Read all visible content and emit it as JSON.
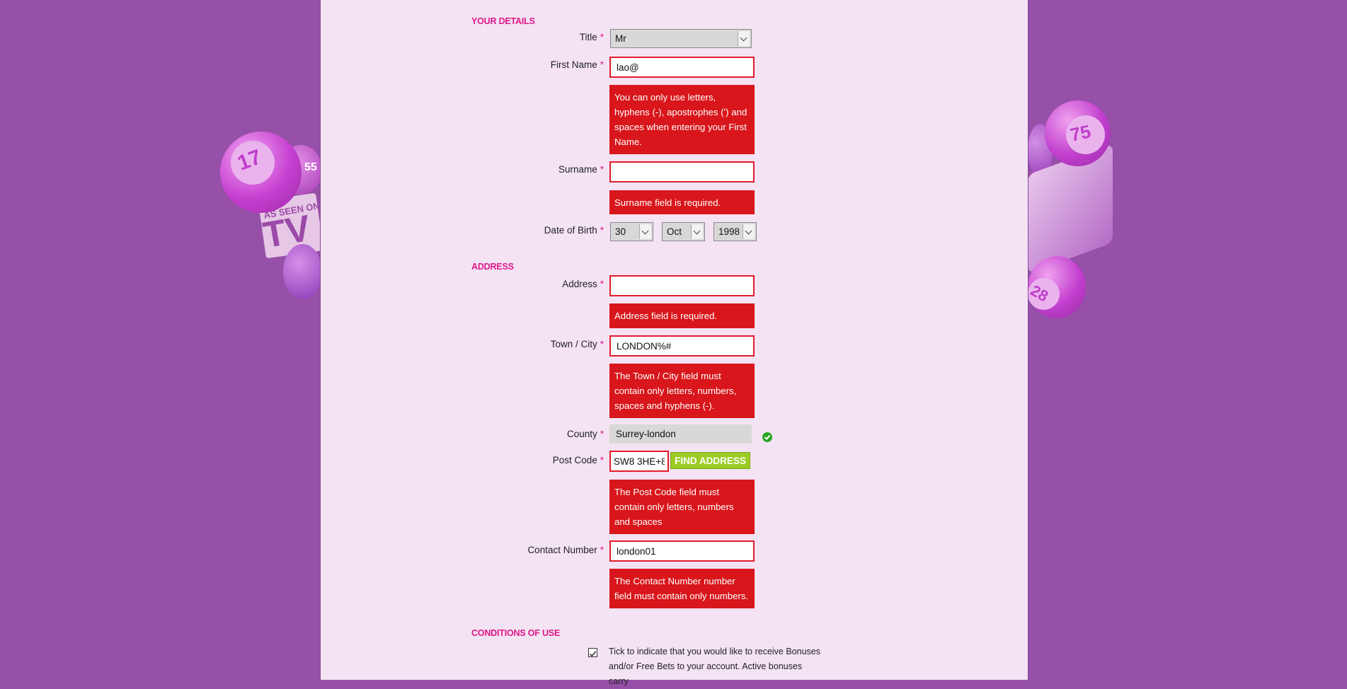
{
  "sections": {
    "details": "YOUR DETAILS",
    "address": "ADDRESS",
    "conditions": "CONDITIONS OF USE"
  },
  "required_mark": "*",
  "fields": {
    "title": {
      "label": "Title",
      "value": "Mr"
    },
    "first_name": {
      "label": "First Name",
      "value": "lao@",
      "error": "You can only use letters, hyphens (-), apostrophes (') and spaces when entering your First Name."
    },
    "surname": {
      "label": "Surname",
      "value": "",
      "error": "Surname field is required."
    },
    "dob": {
      "label": "Date of Birth",
      "day": "30",
      "month": "Oct",
      "year": "1998"
    },
    "address": {
      "label": "Address",
      "value": "",
      "error": "Address field is required."
    },
    "town": {
      "label": "Town / City",
      "value": "LONDON%#",
      "error": "The Town / City field must contain only letters, numbers, spaces and hyphens (-)."
    },
    "county": {
      "label": "County",
      "value": "Surrey-london"
    },
    "postcode": {
      "label": "Post Code",
      "value": "SW8 3HE+8",
      "error": "The Post Code field must contain only letters, numbers and spaces"
    },
    "contact": {
      "label": "Contact Number",
      "value": "london01",
      "error": "The Contact Number number field must contain only numbers."
    }
  },
  "find_address_label": "FIND ADDRESS",
  "consent_text": "Tick to indicate that you would like to receive Bonuses and/or Free Bets to your account. Active bonuses carry",
  "decor": {
    "ball_left_1": "17",
    "ball_left_2": "55",
    "tv_small": "AS SEEN ON",
    "tv_big": "TV",
    "ball_right_1": "75",
    "ball_right_2": "28"
  },
  "colors": {
    "accent": "#e0198a",
    "error": "#d8161b",
    "button": "#9ccc24",
    "background": "#9650a8"
  }
}
